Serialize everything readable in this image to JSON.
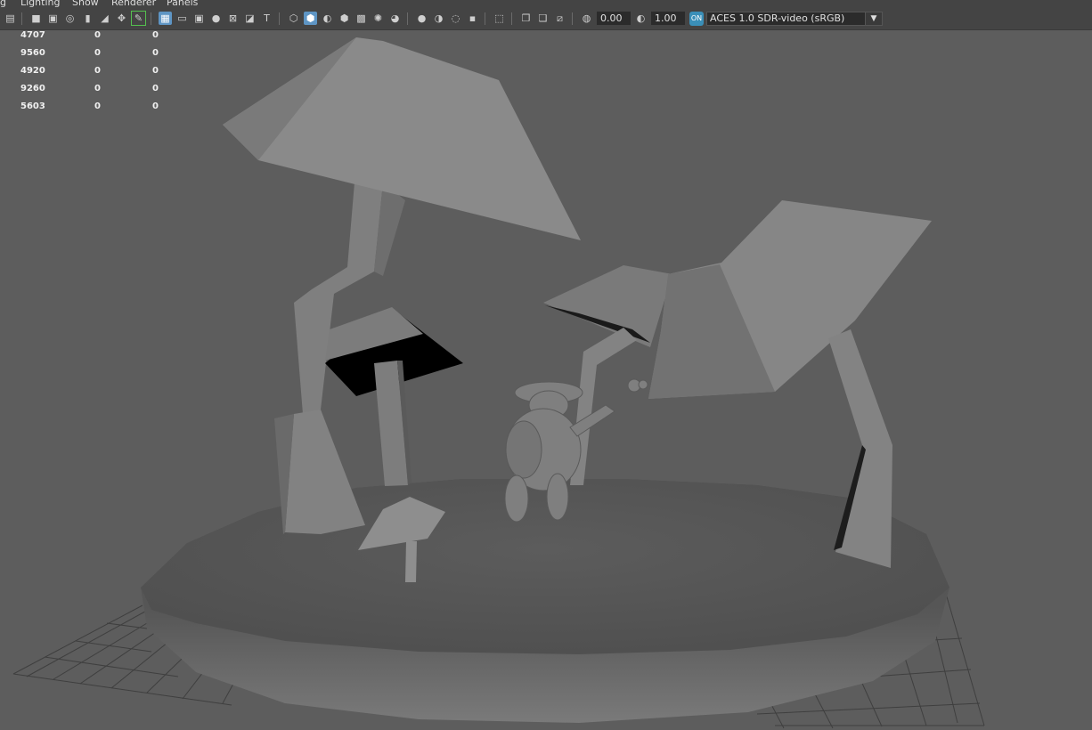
{
  "menus": [
    "g",
    "Lighting",
    "Show",
    "Renderer",
    "Panels"
  ],
  "toolbar": {
    "exposure_value": "0.00",
    "gamma_value": "1.00",
    "colorspace_logo": "ON",
    "colorspace": "ACES 1.0 SDR-video (sRGB)"
  },
  "stats": [
    [
      "4707",
      "0",
      "0"
    ],
    [
      "9560",
      "0",
      "0"
    ],
    [
      "4920",
      "0",
      "0"
    ],
    [
      "9260",
      "0",
      "0"
    ],
    [
      "5603",
      "0",
      "0"
    ]
  ]
}
